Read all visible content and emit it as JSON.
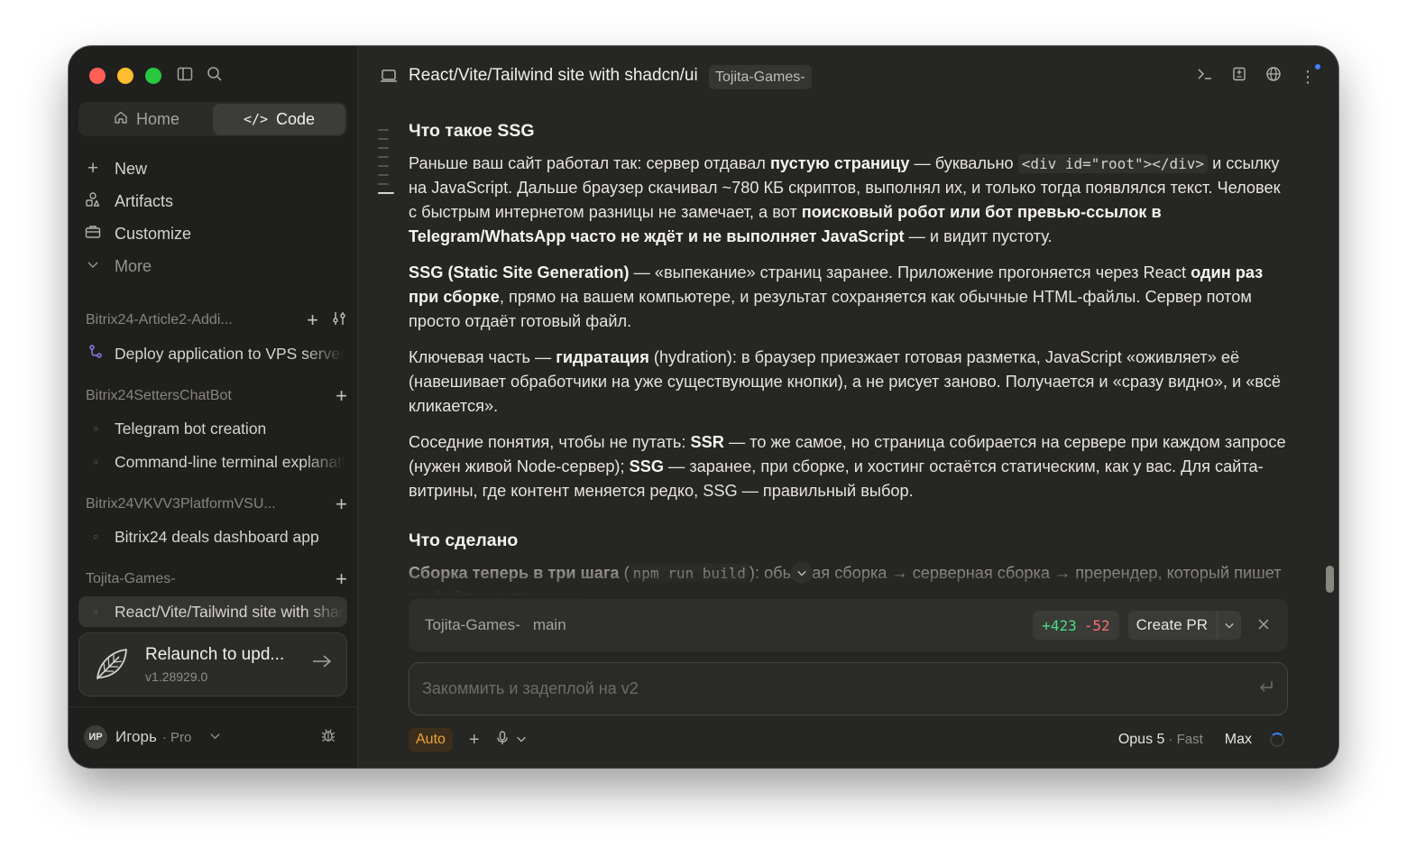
{
  "sidebar": {
    "tabs": {
      "home": "Home",
      "code": "Code"
    },
    "nav": [
      {
        "label": "New",
        "icon": "plus-icon"
      },
      {
        "label": "Artifacts",
        "icon": "artifacts-icon"
      },
      {
        "label": "Customize",
        "icon": "briefcase-icon"
      },
      {
        "label": "More",
        "icon": "chevron-down-icon"
      }
    ],
    "projects": [
      {
        "name": "Bitrix24-Article2-Addi...",
        "items": [
          "Deploy application to VPS server"
        ]
      },
      {
        "name": "Bitrix24SettersChatBot",
        "items": [
          "Telegram bot creation",
          "Command-line terminal explanation"
        ]
      },
      {
        "name": "Bitrix24VKVV3PlatformVSU...",
        "items": [
          "Bitrix24 deals dashboard app"
        ]
      },
      {
        "name": "Tojita-Games-",
        "items": [
          "React/Vite/Tailwind site with shadcn/ui"
        ]
      }
    ],
    "relaunch": {
      "title": "Relaunch to upd...",
      "version": "v1.28929.0"
    },
    "user": {
      "initials": "ИР",
      "name": "Игорь",
      "plan": "· Pro"
    }
  },
  "header": {
    "title": "React/Vite/Tailwind site with shadcn/ui",
    "tag": "Tojita-Games-"
  },
  "content": {
    "h1": "Что такое SSG",
    "p1": {
      "a": "Раньше ваш сайт работал так: сервер отдавал ",
      "b": "пустую страницу",
      "c": " — буквально ",
      "code": "<div id=\"root\"></div>",
      "d": " и ссылку на JavaScript. Дальше браузер скачивал ~780 КБ скриптов, выполнял их, и только тогда появлялся текст. Человек с быстрым интернетом разницы не замечает, а вот ",
      "e": "поисковый робот или бот превью-ссылок в Telegram/WhatsApp часто не ждёт и не выполняет JavaScript",
      "f": " — и видит пустоту."
    },
    "p2": {
      "a": "SSG (Static Site Generation)",
      "b": " — «выпекание» страниц заранее. Приложение прогоняется через React ",
      "c": "один раз при сборке",
      "d": ", прямо на вашем компьютере, и результат сохраняется как обычные HTML-файлы. Сервер потом просто отдаёт готовый файл."
    },
    "p3": {
      "a": "Ключевая часть — ",
      "b": "гидратация",
      "c": " (hydration): в браузер приезжает готовая разметка, JavaScript «оживляет» её (навешивает обработчики на уже существующие кнопки), а не рисует заново. Получается и «сразу видно», и «всё кликается»."
    },
    "p4": {
      "a": "Соседние понятия, чтобы не путать: ",
      "b": "SSR",
      "c": " — то же самое, но страница собирается на сервере при каждом запросе (нужен живой Node-сервер); ",
      "d": "SSG",
      "e": " — заранее, при сборке, и хостинг остаётся статическим, как у вас. Для сайта-витрины, где контент меняется редко, SSG — правильный выбор."
    },
    "h2": "Что сделано",
    "p5": {
      "a": "Сборка теперь в три шага",
      "b": " (",
      "code": "npm run build",
      "c": "): обычная сборка → серверная сборка → пререндер, который пишет по файлу на страницу."
    }
  },
  "gitbar": {
    "repo": "Tojita-Games-",
    "branch": "main",
    "additions": "+423",
    "deletions": "-52",
    "create_pr": "Create PR"
  },
  "composer": {
    "placeholder": "Закоммить и задеплой на v2",
    "mode": "Auto",
    "model": "Opus 5",
    "model_speed": "· Fast",
    "effort": "Max"
  },
  "colors": {
    "accent_orange": "#f0a33a",
    "additions_green": "#4ade80",
    "deletions_red": "#f87171",
    "spinner_blue": "#3b82f6"
  }
}
